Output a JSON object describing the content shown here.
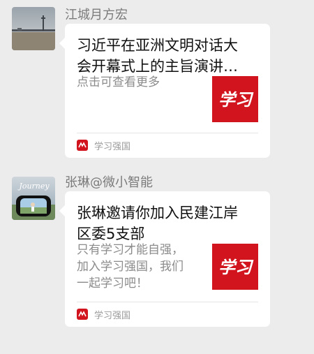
{
  "messages": [
    {
      "sender": "江城月方宏",
      "card": {
        "title": "习近平在亚洲文明对话大\n会开幕式上的主旨演讲…",
        "description": "点击可查看更多",
        "source": "学习强国",
        "thumb_logo": "学习"
      }
    },
    {
      "sender": "张琳@微小智能",
      "avatar_caption": "Journey",
      "card": {
        "title": "张琳邀请你加入民建江岸\n区委5支部",
        "description": "只有学习才能自强，\n加入学习强国，我们\n一起学习吧！",
        "source": "学习强国",
        "thumb_logo": "学习"
      }
    }
  ],
  "colors": {
    "background": "#ececec",
    "bubble": "#ffffff",
    "brand_red": "#d1141e",
    "sender_gray": "#7b7b7b",
    "desc_gray": "#8b8b8b"
  },
  "icons": [
    "xuexi-logo-icon",
    "xuexi-source-icon"
  ]
}
